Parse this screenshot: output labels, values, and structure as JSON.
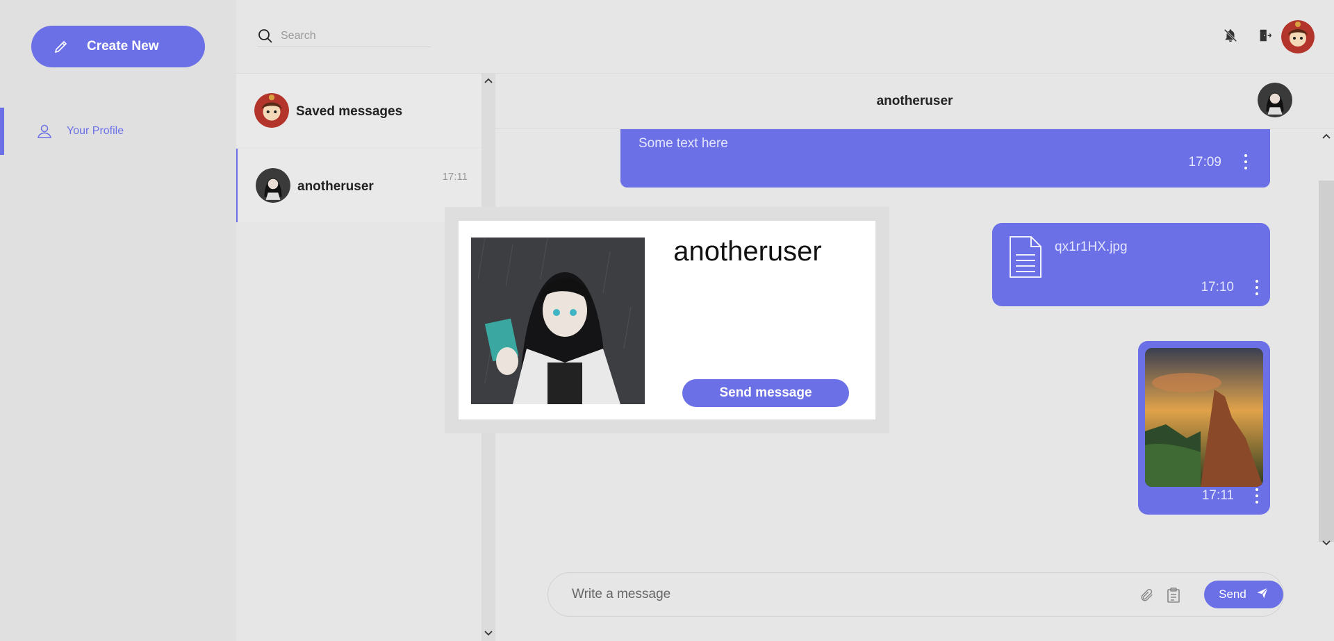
{
  "sidebar": {
    "create_label": "Create New",
    "nav": [
      {
        "label": "Your Profile",
        "icon": "user-icon",
        "active": true
      }
    ]
  },
  "header": {
    "search_placeholder": "Search",
    "icons": [
      "bell-off-icon",
      "logout-icon"
    ]
  },
  "chats": [
    {
      "name": "Saved messages",
      "time": ""
    },
    {
      "name": "anotheruser",
      "time": "17:11"
    }
  ],
  "chat": {
    "title": "anotheruser",
    "messages": [
      {
        "type": "text",
        "text": "Some text here",
        "time": "17:09"
      },
      {
        "type": "file",
        "filename": "qx1r1HX.jpg",
        "time": "17:10",
        "icon": "document-icon"
      },
      {
        "type": "image",
        "time": "17:11"
      }
    ]
  },
  "composer": {
    "placeholder": "Write a message",
    "send_label": "Send",
    "icons": [
      "paperclip-icon",
      "clipboard-icon",
      "send-icon"
    ]
  },
  "profile_popup": {
    "name": "anotheruser",
    "button_label": "Send message"
  },
  "colors": {
    "accent": "#6b70e6",
    "background": "#e6e6e6",
    "sidebar": "#e0e0e0"
  }
}
